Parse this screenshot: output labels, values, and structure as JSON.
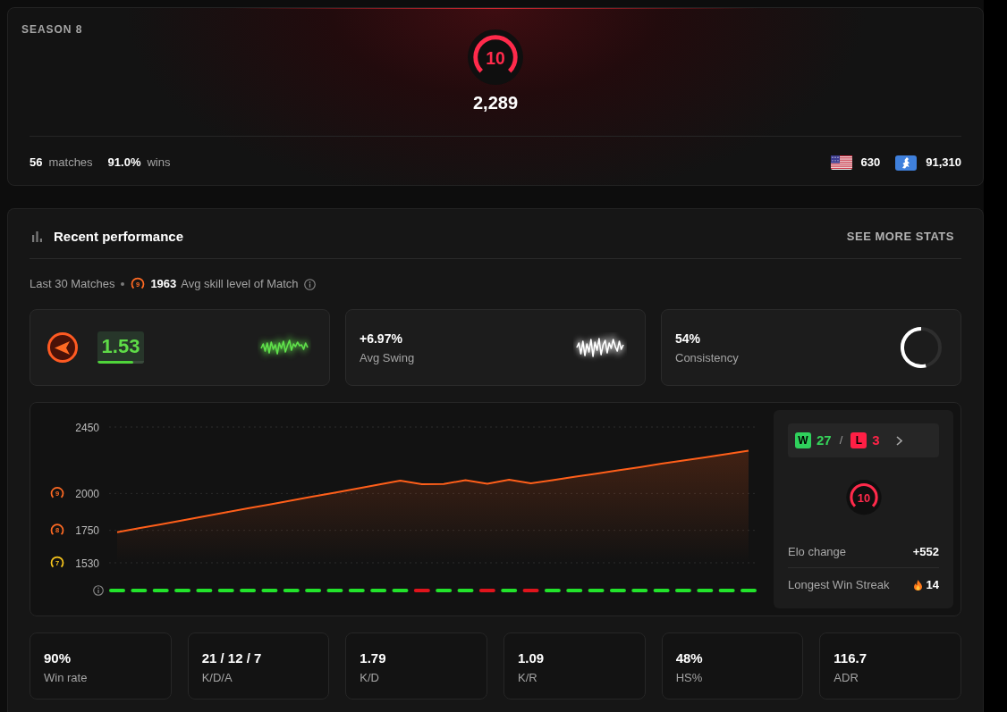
{
  "season_card": {
    "season_label": "SEASON 8",
    "skill_level": "10",
    "elo": "2,289",
    "matches": {
      "value": "56",
      "label": "matches"
    },
    "wins": {
      "value": "91.0%",
      "label": "wins"
    },
    "rankings": [
      {
        "kind": "country",
        "value": "630"
      },
      {
        "kind": "region",
        "value": "91,310"
      }
    ]
  },
  "performance": {
    "title": "Recent performance",
    "see_more": "SEE MORE STATS",
    "summary": {
      "matches_label": "Last 30 Matches",
      "avg_skill_level": "9",
      "avg_elo": "1963",
      "avg_label": "Avg skill level of Match"
    },
    "highlight_cards": [
      {
        "kind": "rating",
        "value": "1.53",
        "level": 0.77
      },
      {
        "kind": "swing",
        "value": "+6.97%",
        "label": "Avg Swing"
      },
      {
        "kind": "consistency",
        "value": "54%",
        "label": "Consistency",
        "level": 0.54
      }
    ],
    "chart": {
      "chart_data": {
        "type": "area",
        "ylim": [
          1530,
          2450
        ],
        "yticks": [
          2450,
          2000,
          1750,
          1530
        ],
        "series": [
          {
            "color": "#ff5f1a",
            "values": [
              1737,
              1764,
              1791,
              1818,
              1845,
              1872,
              1899,
              1925,
              1952,
              1979,
              2006,
              2033,
              2060,
              2086,
              2063,
              2064,
              2090,
              2066,
              2092,
              2068,
              2090,
              2112,
              2134,
              2156,
              2178,
              2201,
              2223,
              2245,
              2267,
              2289
            ]
          }
        ]
      },
      "tick_level_badges": [
        {
          "level": "9",
          "color": "#ff6a23"
        },
        {
          "level": "8",
          "color": "#ff6a23"
        },
        {
          "level": "7",
          "color": "#f7c51c"
        }
      ],
      "match_results": [
        {
          "won": true
        },
        {
          "won": true
        },
        {
          "won": true
        },
        {
          "won": true
        },
        {
          "won": true
        },
        {
          "won": true
        },
        {
          "won": true
        },
        {
          "won": true
        },
        {
          "won": true
        },
        {
          "won": true
        },
        {
          "won": true
        },
        {
          "won": true
        },
        {
          "won": true
        },
        {
          "won": true
        },
        {
          "won": false
        },
        {
          "won": true
        },
        {
          "won": true
        },
        {
          "won": false
        },
        {
          "won": true
        },
        {
          "won": false
        },
        {
          "won": true
        },
        {
          "won": true
        },
        {
          "won": true
        },
        {
          "won": true
        },
        {
          "won": true
        },
        {
          "won": true
        },
        {
          "won": true
        },
        {
          "won": true
        },
        {
          "won": true
        },
        {
          "won": true
        }
      ]
    },
    "record": {
      "win_badge": "W",
      "wins": "27",
      "separator": "/",
      "loss_badge": "L",
      "losses": "3",
      "skill_level": "10",
      "elo_change_label": "Elo change",
      "elo_change": "+552",
      "streak_label": "Longest Win Streak",
      "streak": "14"
    },
    "stats": [
      {
        "value": "90%",
        "label": "Win rate"
      },
      {
        "value": "21 / 12 / 7",
        "label": "K/D/A"
      },
      {
        "value": "1.79",
        "label": "K/D"
      },
      {
        "value": "1.09",
        "label": "K/R"
      },
      {
        "value": "48%",
        "label": "HS%"
      },
      {
        "value": "116.7",
        "label": "ADR"
      }
    ]
  }
}
